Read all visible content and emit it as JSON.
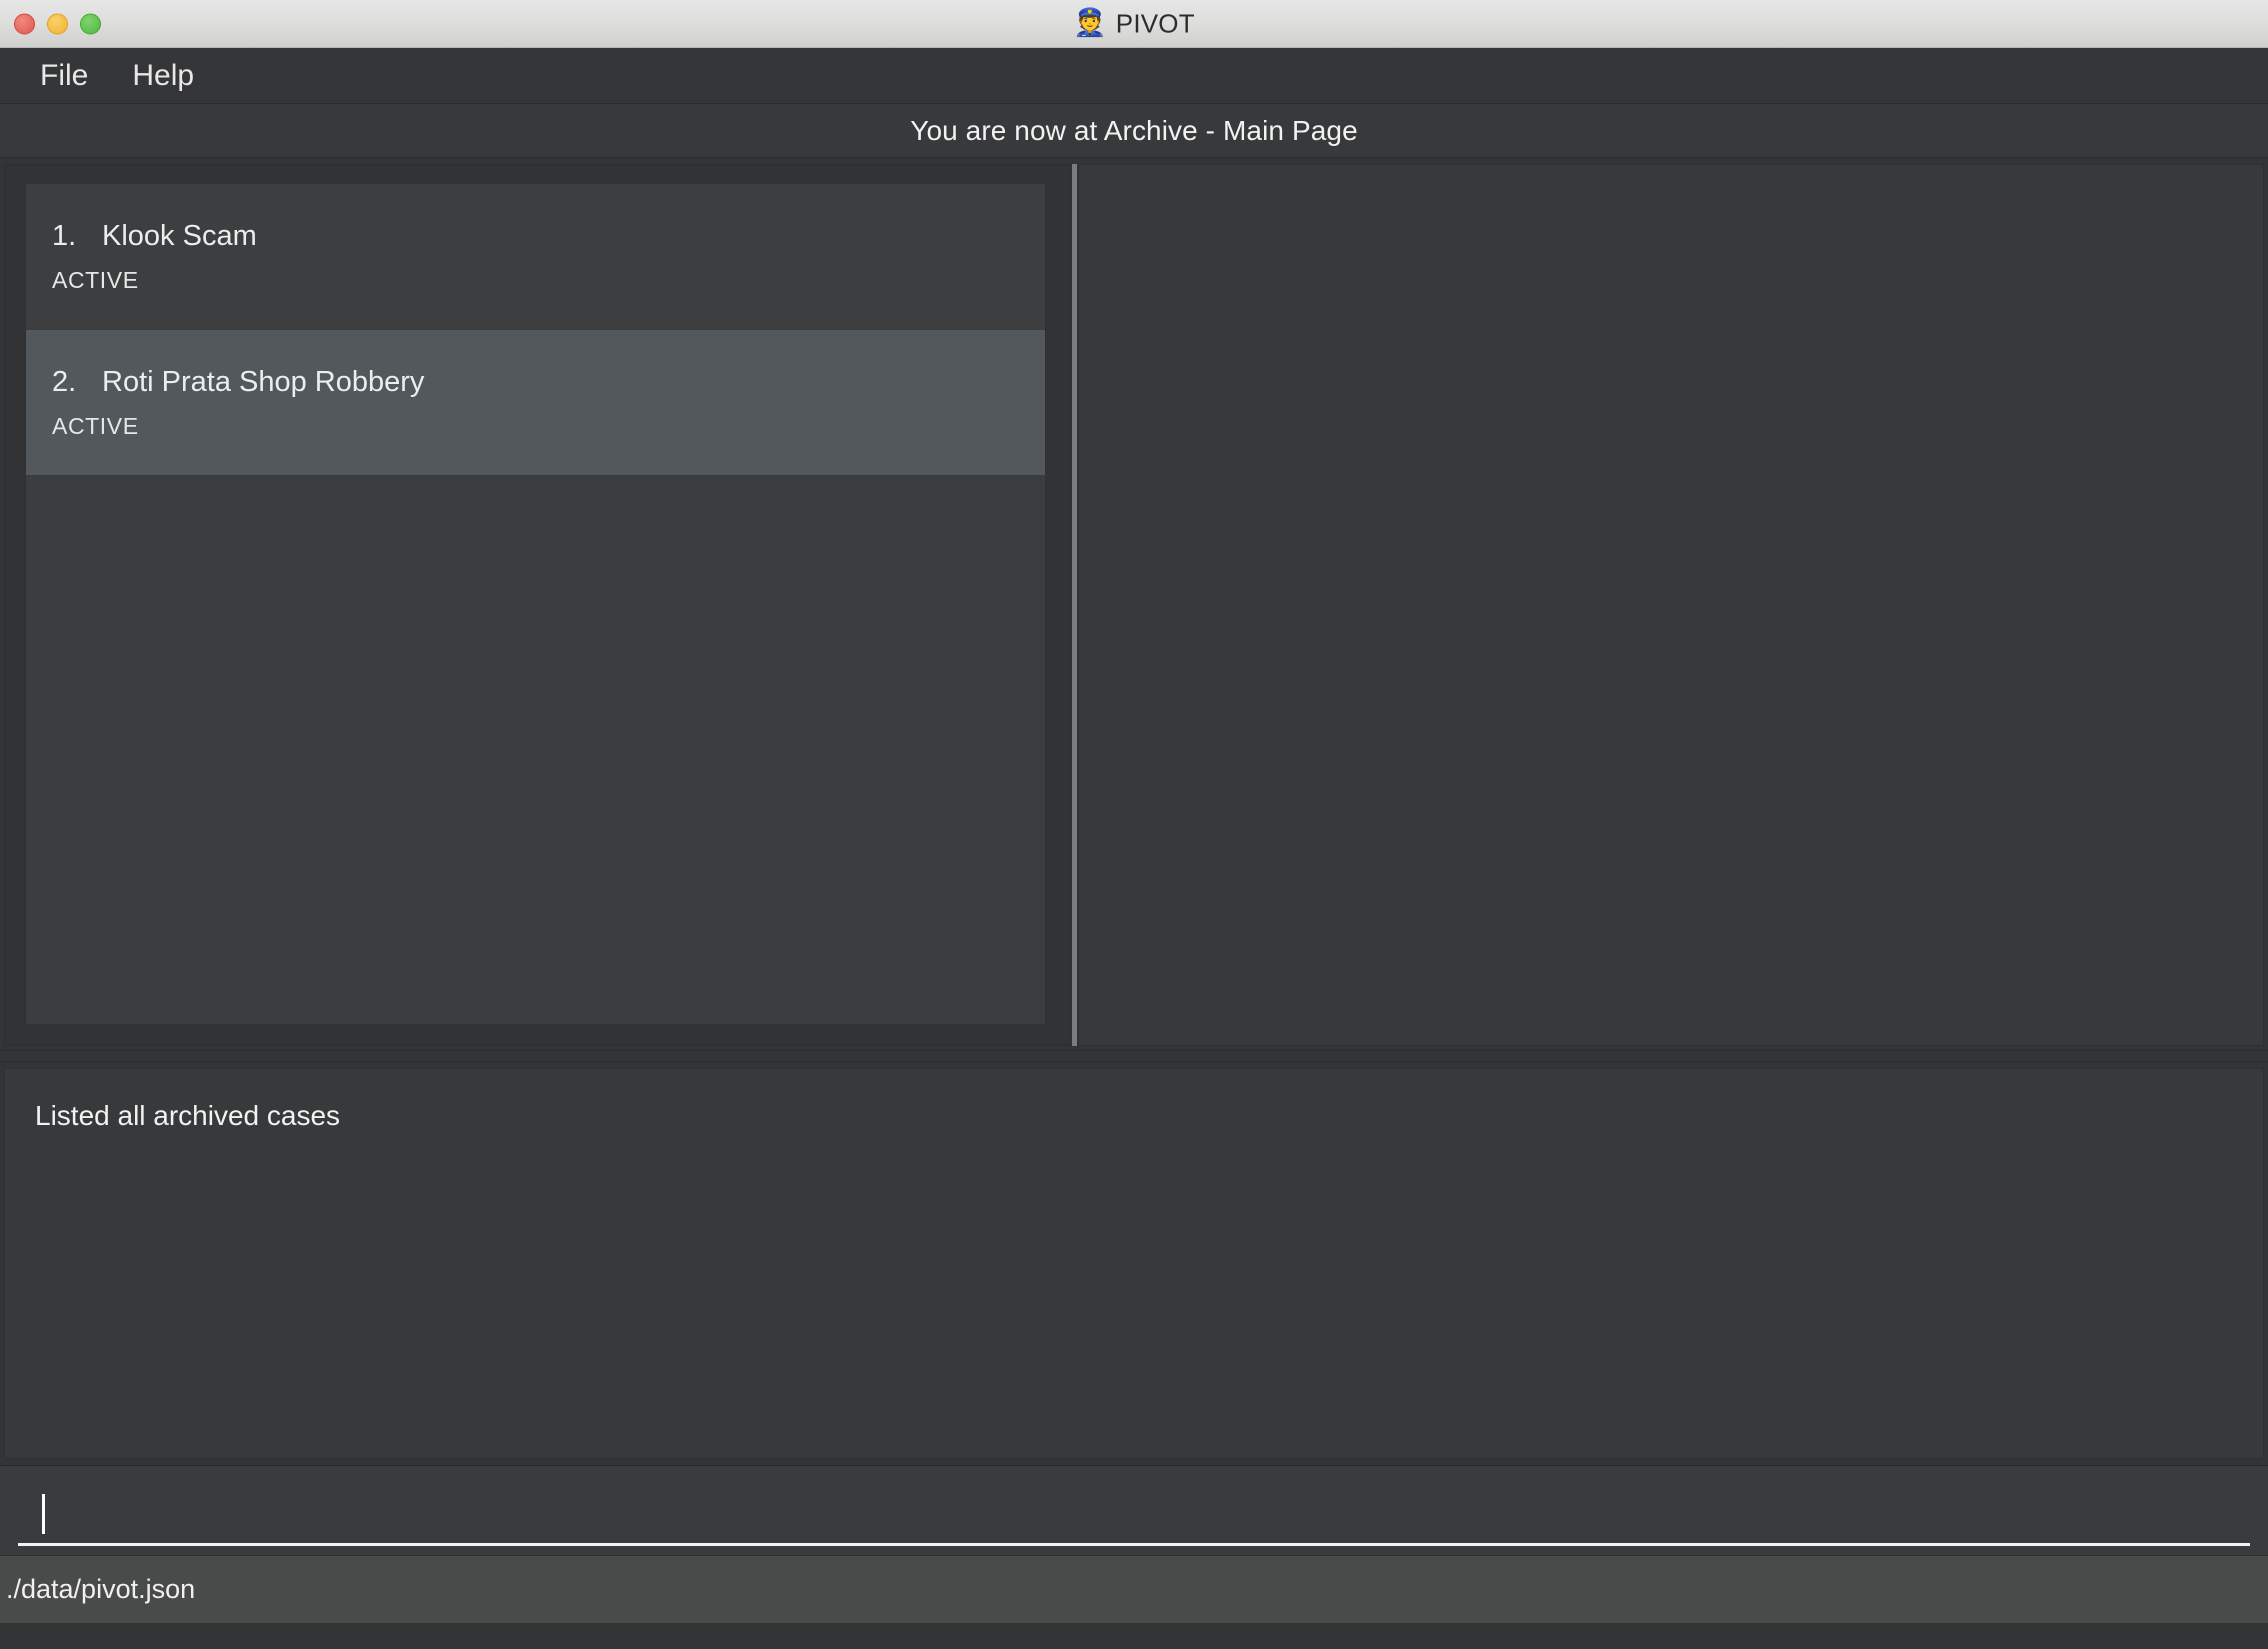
{
  "window": {
    "title": "PIVOT",
    "icon": "police-officer-icon",
    "traffic_lights": {
      "close_color": "#e2564c",
      "minimize_color": "#f1b32f",
      "maximize_color": "#4eb83f"
    }
  },
  "menubar": {
    "items": [
      {
        "label": "File",
        "name": "menu-file"
      },
      {
        "label": "Help",
        "name": "menu-help"
      }
    ]
  },
  "location": {
    "text": "You are now at Archive - Main Page"
  },
  "case_list": {
    "items": [
      {
        "index": "1.",
        "name": "Klook Scam",
        "status": "ACTIVE",
        "selected": false
      },
      {
        "index": "2.",
        "name": "Roti Prata Shop Robbery",
        "status": "ACTIVE",
        "selected": true
      }
    ]
  },
  "right_panel": {
    "content": ""
  },
  "results": {
    "text": "Listed all archived cases"
  },
  "command_input": {
    "value": "",
    "placeholder": ""
  },
  "statusbar": {
    "file_path": "./data/pivot.json"
  },
  "colors": {
    "app_background": "#333436",
    "panel_background": "#37393a",
    "list_item_background": "#3c3e40",
    "list_item_selected_background": "#53585c",
    "statusbar_background": "#494a4a",
    "text_primary": "#f2f2f2",
    "splitter": "#7a7c7e"
  }
}
